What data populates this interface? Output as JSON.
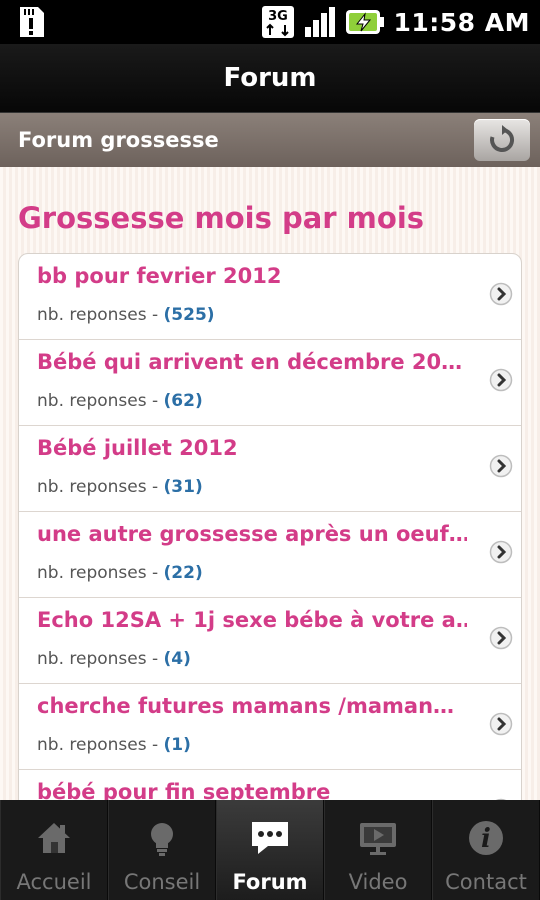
{
  "status_bar": {
    "network": "3G",
    "time": "11:58 AM"
  },
  "header": {
    "title": "Forum"
  },
  "subheader": {
    "title": "Forum grossesse",
    "refresh_icon": "refresh-icon"
  },
  "section": {
    "title": "Grossesse mois par mois"
  },
  "reply_label": "nb. reponses - ",
  "topics": [
    {
      "title": "bb pour fevrier 2012",
      "count": "(525)"
    },
    {
      "title": "Bébé qui arrivent en décembre 20…",
      "count": "(62)"
    },
    {
      "title": "Bébé juillet 2012",
      "count": "(31)"
    },
    {
      "title": "une autre grossesse après un oeuf…",
      "count": "(22)"
    },
    {
      "title": "Echo 12SA + 1j sexe bébe à votre a…",
      "count": "(4)"
    },
    {
      "title": "cherche futures mamans /maman…",
      "count": "(1)"
    },
    {
      "title": "bébé pour fin septembre",
      "count": ""
    }
  ],
  "tabs": [
    {
      "label": "Accueil",
      "icon": "home-icon",
      "active": false
    },
    {
      "label": "Conseil",
      "icon": "lightbulb-icon",
      "active": false
    },
    {
      "label": "Forum",
      "icon": "chat-bubble-icon",
      "active": true
    },
    {
      "label": "Video",
      "icon": "video-icon",
      "active": false
    },
    {
      "label": "Contact",
      "icon": "info-icon",
      "active": false
    }
  ],
  "colors": {
    "accent": "#d33c88",
    "count": "#2c6fa6",
    "subheader": "#7a6f69"
  }
}
